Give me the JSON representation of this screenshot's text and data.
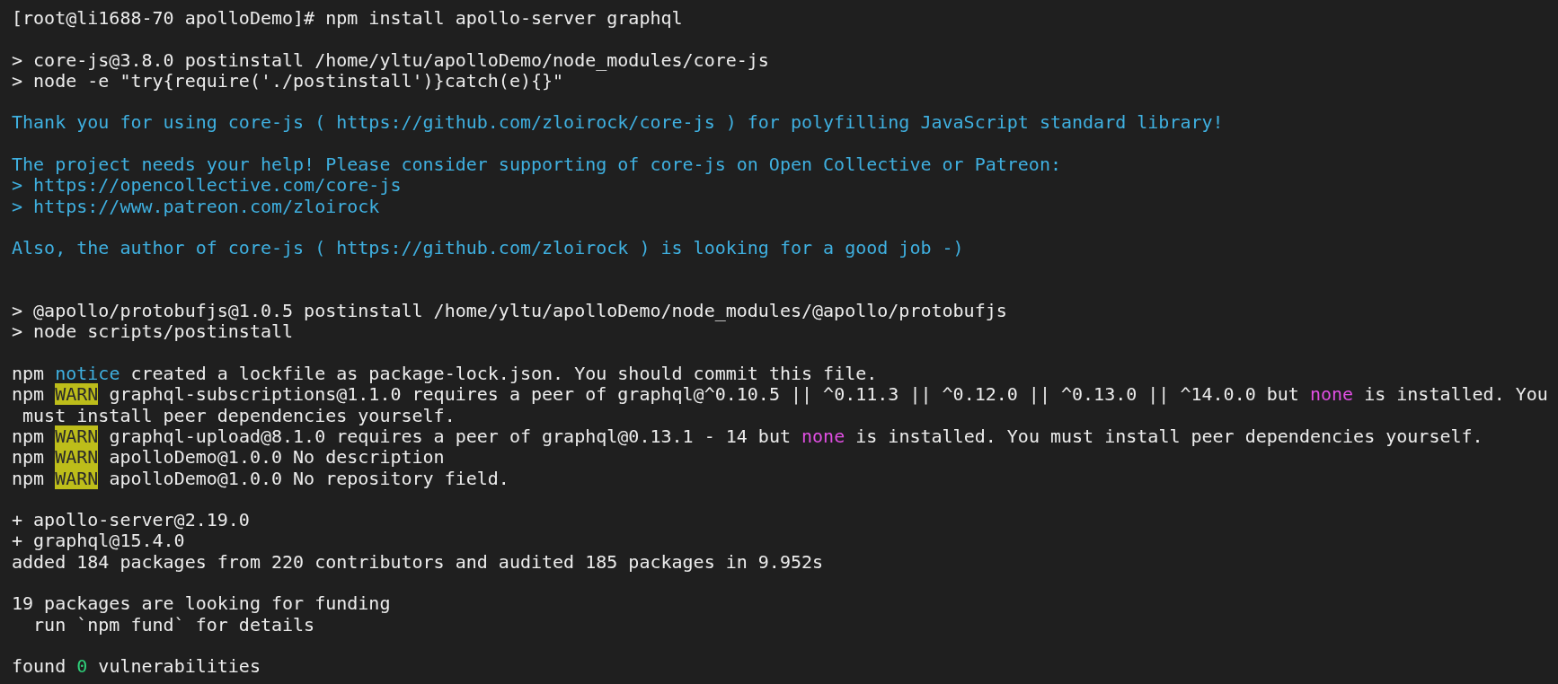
{
  "terminal": {
    "lines": [
      {
        "kind": "text",
        "segments": [
          {
            "kind": "plain",
            "text": "[root@li1688-70 apolloDemo]# npm install apollo-server graphql"
          }
        ]
      },
      {
        "kind": "blank"
      },
      {
        "kind": "text",
        "segments": [
          {
            "kind": "plain",
            "text": "> core-js@3.8.0 postinstall /home/yltu/apolloDemo/node_modules/core-js"
          }
        ]
      },
      {
        "kind": "text",
        "segments": [
          {
            "kind": "plain",
            "text": "> node -e \"try{require('./postinstall')}catch(e){}\""
          }
        ]
      },
      {
        "kind": "blank"
      },
      {
        "kind": "text",
        "segments": [
          {
            "kind": "cyan",
            "text": "Thank you for using core-js ( https://github.com/zloirock/core-js ) for polyfilling JavaScript standard library!"
          }
        ]
      },
      {
        "kind": "blank"
      },
      {
        "kind": "text",
        "segments": [
          {
            "kind": "cyan",
            "text": "The project needs your help! Please consider supporting of core-js on Open Collective or Patreon:"
          }
        ]
      },
      {
        "kind": "text",
        "segments": [
          {
            "kind": "cyan",
            "text": "> https://opencollective.com/core-js"
          }
        ]
      },
      {
        "kind": "text",
        "segments": [
          {
            "kind": "cyan",
            "text": "> https://www.patreon.com/zloirock"
          }
        ]
      },
      {
        "kind": "blank"
      },
      {
        "kind": "text",
        "segments": [
          {
            "kind": "cyan",
            "text": "Also, the author of core-js ( https://github.com/zloirock ) is looking for a good job -)"
          }
        ]
      },
      {
        "kind": "blank"
      },
      {
        "kind": "blank"
      },
      {
        "kind": "text",
        "segments": [
          {
            "kind": "plain",
            "text": "> @apollo/protobufjs@1.0.5 postinstall /home/yltu/apolloDemo/node_modules/@apollo/protobufjs"
          }
        ]
      },
      {
        "kind": "text",
        "segments": [
          {
            "kind": "plain",
            "text": "> node scripts/postinstall"
          }
        ]
      },
      {
        "kind": "blank"
      },
      {
        "kind": "text",
        "segments": [
          {
            "kind": "plain",
            "text": "npm "
          },
          {
            "kind": "cyan",
            "text": "notice"
          },
          {
            "kind": "plain",
            "text": " created a lockfile as package-lock.json. You should commit this file."
          }
        ]
      },
      {
        "kind": "text",
        "segments": [
          {
            "kind": "plain",
            "text": "npm "
          },
          {
            "kind": "warn",
            "text": "WARN"
          },
          {
            "kind": "plain",
            "text": " graphql-subscriptions@1.1.0 requires a peer of graphql@^0.10.5 || ^0.11.3 || ^0.12.0 || ^0.13.0 || ^14.0.0 but "
          },
          {
            "kind": "magenta",
            "text": "none"
          },
          {
            "kind": "plain",
            "text": " is installed. You"
          }
        ]
      },
      {
        "kind": "text",
        "segments": [
          {
            "kind": "plain",
            "text": " must install peer dependencies yourself."
          }
        ]
      },
      {
        "kind": "text",
        "segments": [
          {
            "kind": "plain",
            "text": "npm "
          },
          {
            "kind": "warn",
            "text": "WARN"
          },
          {
            "kind": "plain",
            "text": " graphql-upload@8.1.0 requires a peer of graphql@0.13.1 - 14 but "
          },
          {
            "kind": "magenta",
            "text": "none"
          },
          {
            "kind": "plain",
            "text": " is installed. You must install peer dependencies yourself."
          }
        ]
      },
      {
        "kind": "text",
        "segments": [
          {
            "kind": "plain",
            "text": "npm "
          },
          {
            "kind": "warn",
            "text": "WARN"
          },
          {
            "kind": "plain",
            "text": " apolloDemo@1.0.0 No description"
          }
        ]
      },
      {
        "kind": "text",
        "segments": [
          {
            "kind": "plain",
            "text": "npm "
          },
          {
            "kind": "warn",
            "text": "WARN"
          },
          {
            "kind": "plain",
            "text": " apolloDemo@1.0.0 No repository field."
          }
        ]
      },
      {
        "kind": "blank"
      },
      {
        "kind": "text",
        "segments": [
          {
            "kind": "plain",
            "text": "+ apollo-server@2.19.0"
          }
        ]
      },
      {
        "kind": "text",
        "segments": [
          {
            "kind": "plain",
            "text": "+ graphql@15.4.0"
          }
        ]
      },
      {
        "kind": "text",
        "segments": [
          {
            "kind": "plain",
            "text": "added 184 packages from 220 contributors and audited 185 packages in 9.952s"
          }
        ]
      },
      {
        "kind": "blank"
      },
      {
        "kind": "text",
        "segments": [
          {
            "kind": "plain",
            "text": "19 packages are looking for funding"
          }
        ]
      },
      {
        "kind": "text",
        "segments": [
          {
            "kind": "plain",
            "text": "  run `npm fund` for details"
          }
        ]
      },
      {
        "kind": "blank"
      },
      {
        "kind": "text",
        "segments": [
          {
            "kind": "plain",
            "text": "found "
          },
          {
            "kind": "green",
            "text": "0"
          },
          {
            "kind": "plain",
            "text": " vulnerabilities"
          }
        ]
      }
    ]
  }
}
